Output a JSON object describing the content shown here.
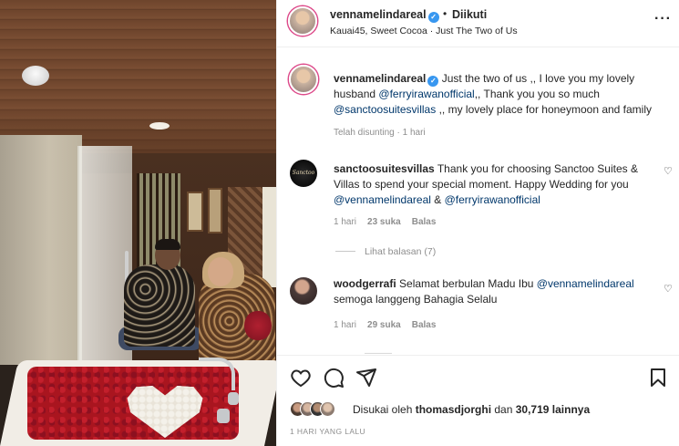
{
  "post": {
    "username": "vennamelindareal",
    "follow_status": "Diikuti",
    "bullet": "•",
    "subtitle": "Kauai45, Sweet Cocoa · Just The Two of Us",
    "more_icon": "more-horizontal-icon"
  },
  "caption": {
    "username": "vennamelindareal",
    "text_before": "Just the two of us ,, I love you my lovely husband ",
    "mention1": "@ferryirawanofficial",
    "text_middle": ",, Thank you you so much ",
    "mention2": "@sanctoosuitesvillas",
    "text_after": " ,, my lovely place for honeymoon and family",
    "meta": "Telah disunting · 1 hari"
  },
  "comments": [
    {
      "username": "sanctoosuitesvillas",
      "avatar_text": "Sanctoo",
      "text_before": "Thank you for choosing Sanctoo Suites & Villas to spend your special moment. Happy Wedding for you ",
      "mention1": "@vennamelindareal",
      "joiner": " & ",
      "mention2": "@ferryirawanofficial",
      "time": "1 hari",
      "likes": "23 suka",
      "reply": "Balas",
      "view_replies": "Lihat balasan (7)"
    },
    {
      "username": "woodgerrafi",
      "text_before": "Selamat berbulan Madu Ibu ",
      "mention1": "@vennamelindareal",
      "text_after": " semoga langgeng Bahagia Selalu",
      "time": "1 hari",
      "likes": "29 suka",
      "reply": "Balas"
    }
  ],
  "actions": {
    "liked_by_prefix": "Disukai oleh ",
    "liked_by_user": "thomasdjorghi",
    "liked_by_joiner": " dan ",
    "liked_by_count": "30,719 lainnya",
    "time_ago": "1 HARI YANG LALU"
  },
  "colors": {
    "mention": "#00376b",
    "story_ring": "#dd4a8a",
    "verified": "#3897f0",
    "muted": "#8e8e8e"
  }
}
